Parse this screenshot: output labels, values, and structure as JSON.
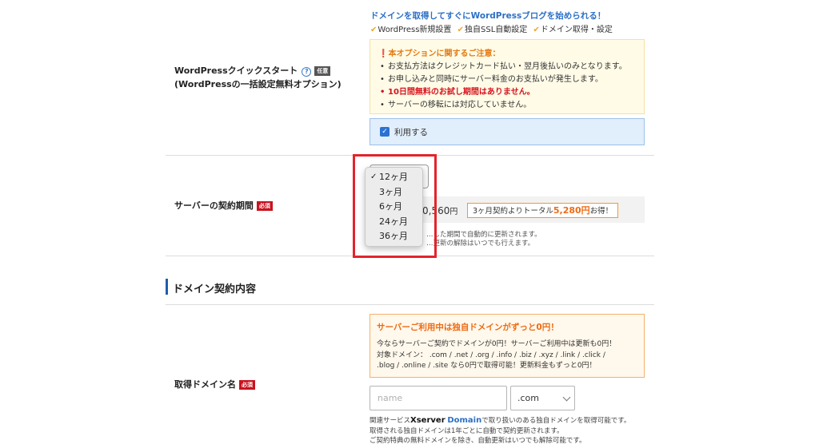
{
  "wordpress": {
    "label_line1": "WordPressクイックスタート",
    "label_line2": "(WordPressの一括設定無料オプション)",
    "help_glyph": "?",
    "optional_badge": "任意",
    "headline": "ドメインを取得してすぐにWordPressブログを始められる！",
    "features": [
      "WordPress新規設置",
      "独自SSL自動設定",
      "ドメイン取得・設定"
    ],
    "notice_title": "❗本オプションに関するご注意：",
    "notice_items": [
      "お支払方法はクレジットカード払い・翌月後払いのみとなります。",
      "お申し込みと同時にサーバー料金のお支払いが発生します。",
      "10日間無料のお試し期間はありません。",
      "サーバーの移転には対応していません。"
    ],
    "use_label": "利用する",
    "use_checked": true
  },
  "contract": {
    "label": "サーバーの契約期間",
    "required_badge": "必須",
    "selected": "12ヶ月",
    "options": [
      "12ヶ月",
      "3ヶ月",
      "6ヶ月",
      "24ヶ月",
      "36ヶ月"
    ],
    "price_visible": "0,560",
    "price_unit": "円",
    "save_prefix": "3ヶ月契約よりトータル",
    "save_amount": "5,280円",
    "save_suffix": "お得！",
    "note_line1": "…した期間で自動的に更新されます。",
    "note_line2": "…更新の解除はいつでも行えます。"
  },
  "domain_section": {
    "title": "ドメイン契約内容"
  },
  "domain": {
    "label": "取得ドメイン名",
    "required_badge": "必須",
    "promo_title": "サーバーご利用中は独自ドメインがずっと0円！",
    "promo_line1": "今ならサーバーご契約でドメインが0円！サーバーご利用中は更新も0円！",
    "promo_line2": "対象ドメイン： .com / .net / .org / .info / .biz / .xyz / .link / .click /",
    "promo_line3": ".blog / .online / .site なら0円で取得可能！更新料金もずっと0円！",
    "name_placeholder": "name",
    "name_value": "",
    "tld_selected": ".com",
    "fine_prefix": "関連サービス",
    "fine_brand1": "Xserver",
    "fine_brand2": "Domain",
    "fine_suffix": "で取り扱いのある独自ドメインを取得可能です。",
    "fine_line2": "取得される独自ドメインは1年ごとに自動で契約更新されます。",
    "fine_line3": "ご契約特典の無料ドメインを除き、自動更新はいつでも解除可能です。"
  },
  "colors": {
    "required_red": "#c8131f",
    "link_blue": "#2c6fc6",
    "warning_orange": "#ee6b14",
    "highlight_red": "#e3242b"
  }
}
